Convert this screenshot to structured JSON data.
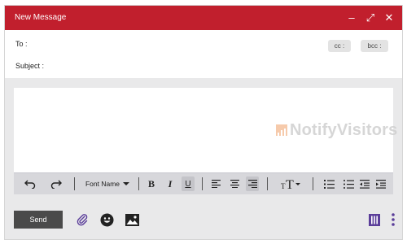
{
  "window": {
    "title": "New Message",
    "minimize_label": "–",
    "expand_label": "⤢",
    "close_label": "✕"
  },
  "fields": {
    "to_label": "To :",
    "cc_label": "cc :",
    "bcc_label": "bcc :",
    "subject_label": "Subject :"
  },
  "watermark": {
    "text": "NotifyVisitors"
  },
  "toolbar": {
    "font_name_label": "Font Name",
    "bold_label": "B",
    "italic_label": "I",
    "underline_label": "U"
  },
  "actions": {
    "send_label": "Send"
  },
  "colors": {
    "titlebar": "#c11f2d",
    "send_button": "#4a4a4a",
    "icon_accent": "#5b3e9a"
  }
}
